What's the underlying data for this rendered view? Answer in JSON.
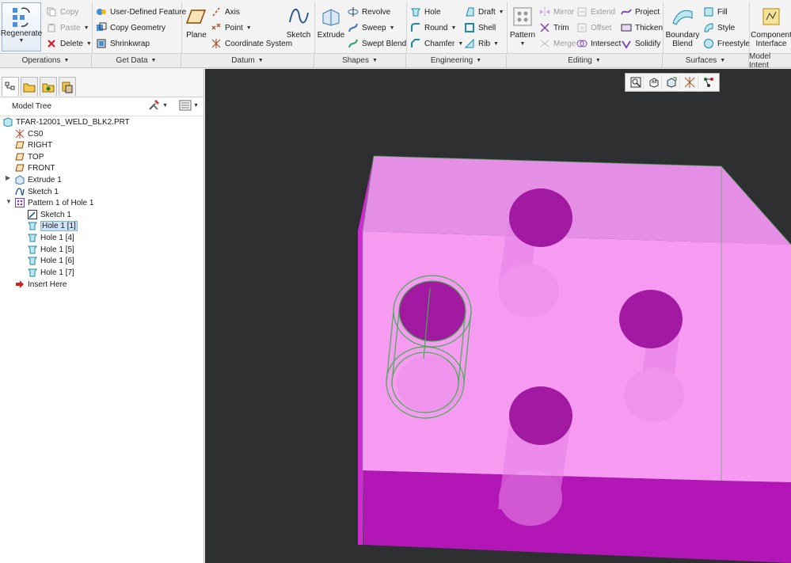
{
  "ribbon": {
    "regenerate": "Regenerate",
    "operations": {
      "copy": "Copy",
      "paste": "Paste",
      "delete": "Delete",
      "group": "Operations"
    },
    "get_data": {
      "udf": "User-Defined Feature",
      "copy_geometry": "Copy Geometry",
      "shrinkwrap": "Shrinkwrap",
      "group": "Get Data"
    },
    "datum": {
      "plane": "Plane",
      "axis": "Axis",
      "point": "Point",
      "coordinate_system": "Coordinate System",
      "sketch": "Sketch",
      "group": "Datum"
    },
    "shapes": {
      "extrude": "Extrude",
      "revolve": "Revolve",
      "sweep": "Sweep",
      "swept_blend": "Swept Blend",
      "group": "Shapes"
    },
    "engineering": {
      "hole": "Hole",
      "round": "Round",
      "chamfer": "Chamfer",
      "draft": "Draft",
      "shell": "Shell",
      "rib": "Rib",
      "group": "Engineering"
    },
    "editing": {
      "pattern": "Pattern",
      "mirror": "Mirror",
      "trim": "Trim",
      "merge": "Merge",
      "extend": "Extend",
      "offset": "Offset",
      "intersect": "Intersect",
      "project": "Project",
      "thicken": "Thicken",
      "solidify": "Solidify",
      "group": "Editing"
    },
    "surfaces": {
      "boundary_blend_1": "Boundary",
      "boundary_blend_2": "Blend",
      "fill": "Fill",
      "style": "Style",
      "freestyle": "Freestyle",
      "group": "Surfaces"
    },
    "model_intent": {
      "component_1": "Component",
      "component_2": "Interface",
      "group": "Model Intent"
    }
  },
  "tree": {
    "title": "Model Tree",
    "items": [
      {
        "label": "TFAR-12001_WELD_BLK2.PRT"
      },
      {
        "label": "CS0"
      },
      {
        "label": "RIGHT"
      },
      {
        "label": "TOP"
      },
      {
        "label": "FRONT"
      },
      {
        "label": "Extrude 1"
      },
      {
        "label": "Sketch 1"
      },
      {
        "label": "Pattern 1 of Hole 1"
      },
      {
        "label": "Sketch 1"
      },
      {
        "label": "Hole 1 [1]"
      },
      {
        "label": "Hole 1 [4]"
      },
      {
        "label": "Hole 1 [5]"
      },
      {
        "label": "Hole 1 [6]"
      },
      {
        "label": "Hole 1 [7]"
      },
      {
        "label": "Insert Here"
      }
    ]
  },
  "colors": {
    "part_front": "#f799f2",
    "part_top": "#e58ee6",
    "part_side": "#d626d8",
    "part_bottom": "#b316b6",
    "hole_dark": "#a21aa2",
    "highlight": "#3cb14a",
    "viewport_bg": "#2d2f30"
  }
}
